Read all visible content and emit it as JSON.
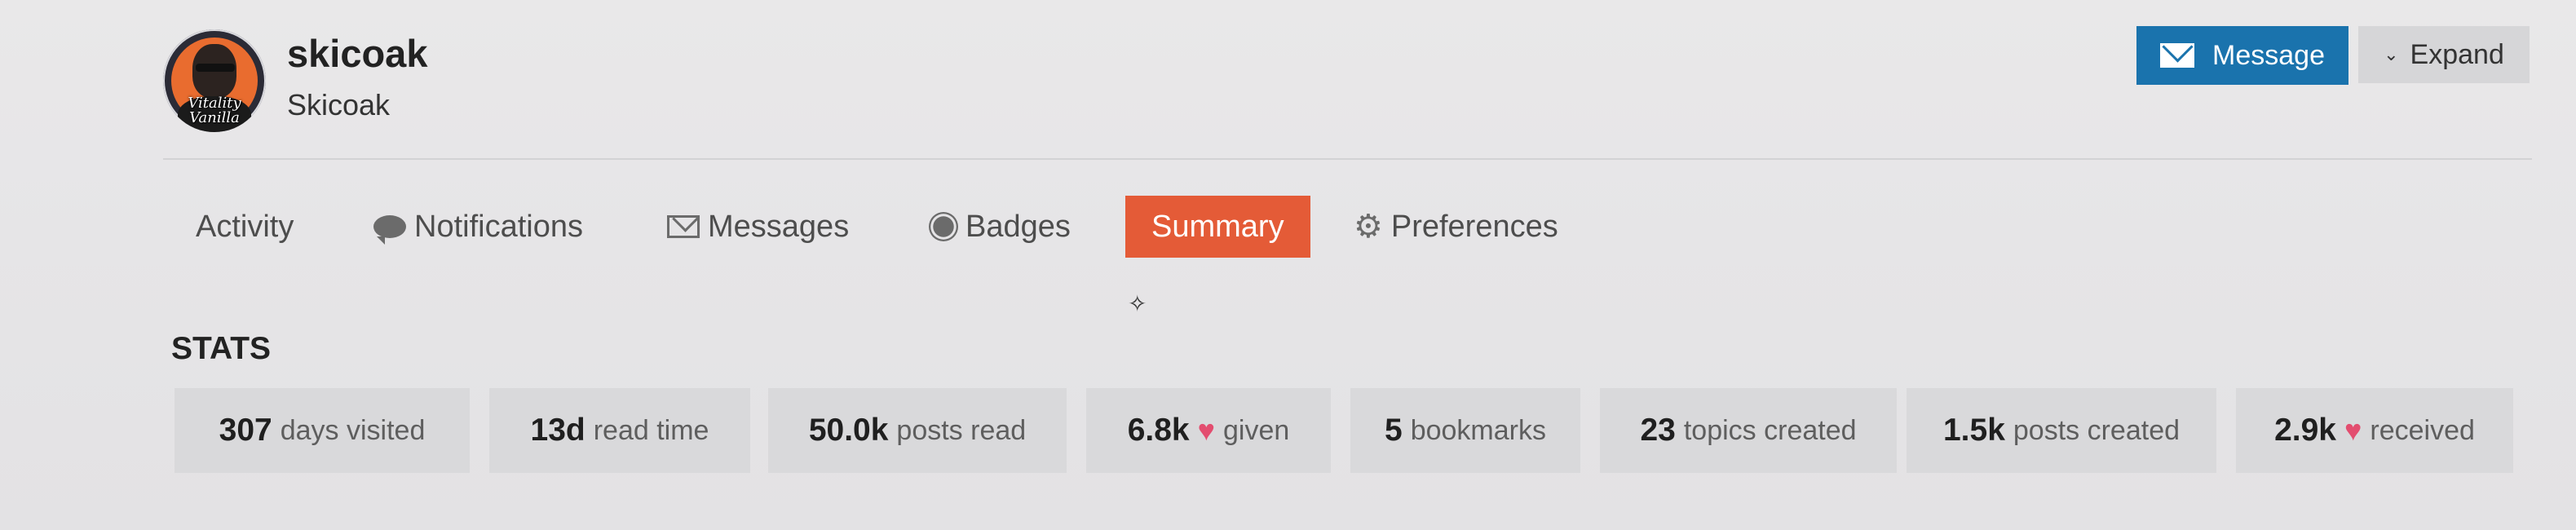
{
  "user": {
    "username": "skicoak",
    "full_name": "Skicoak",
    "avatar_text": "Vitality Vanilla"
  },
  "actions": {
    "message_label": "Message",
    "expand_label": "Expand"
  },
  "nav": {
    "items": [
      {
        "label": "Activity",
        "icon": "none"
      },
      {
        "label": "Notifications",
        "icon": "speech-bubble-icon"
      },
      {
        "label": "Messages",
        "icon": "envelope-icon"
      },
      {
        "label": "Badges",
        "icon": "badge-icon"
      },
      {
        "label": "Summary",
        "icon": "none",
        "active": true
      },
      {
        "label": "Preferences",
        "icon": "gear-icon"
      }
    ]
  },
  "stats": {
    "title": "STATS",
    "items": [
      {
        "value": "307",
        "label": "days visited"
      },
      {
        "value": "13d",
        "label": "read time"
      },
      {
        "value": "50.0k",
        "label": "posts read"
      },
      {
        "value": "6.8k",
        "label": "given",
        "icon": "heart-icon"
      },
      {
        "value": "5",
        "label": "bookmarks"
      },
      {
        "value": "23",
        "label": "topics created"
      },
      {
        "value": "1.5k",
        "label": "posts created"
      },
      {
        "value": "2.9k",
        "label": "received",
        "icon": "heart-icon"
      }
    ]
  },
  "colors": {
    "primary": "#1a73ad",
    "accent": "#e45b37",
    "heart": "#e34d6f",
    "stat_bg": "#d9d9db"
  }
}
